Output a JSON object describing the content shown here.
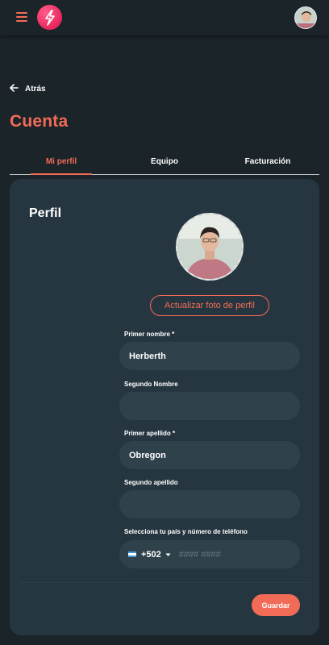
{
  "header": {
    "menu_icon": "hamburger-menu-icon",
    "logo_icon": "lightning-bolt-icon",
    "avatar": "user-avatar"
  },
  "nav": {
    "back_label": "Atrás",
    "back_icon": "arrow-left-icon"
  },
  "page": {
    "title": "Cuenta"
  },
  "tabs": [
    {
      "label": "Mi perfil",
      "active": true
    },
    {
      "label": "Equipo",
      "active": false
    },
    {
      "label": "Facturación",
      "active": false
    }
  ],
  "profile": {
    "title": "Perfil",
    "update_photo_label": "Actualizar foto de perfil",
    "fields": {
      "first_name": {
        "label": "Primer nombre *",
        "value": "Herberth"
      },
      "middle_name": {
        "label": "Segundo Nombre",
        "value": ""
      },
      "first_surname": {
        "label": "Primer apellido *",
        "value": "Obregon"
      },
      "second_surname": {
        "label": "Segundo apellido",
        "value": ""
      }
    },
    "phone": {
      "label": "Selecciona tu país y número de teléfono",
      "country_code": "+502",
      "flag": "guatemala-flag-icon",
      "placeholder": "#### ####"
    },
    "save_label": "Guardar"
  },
  "colors": {
    "accent": "#f26b57",
    "background": "#1b2429",
    "card": "#263640",
    "input": "#2f414b"
  }
}
